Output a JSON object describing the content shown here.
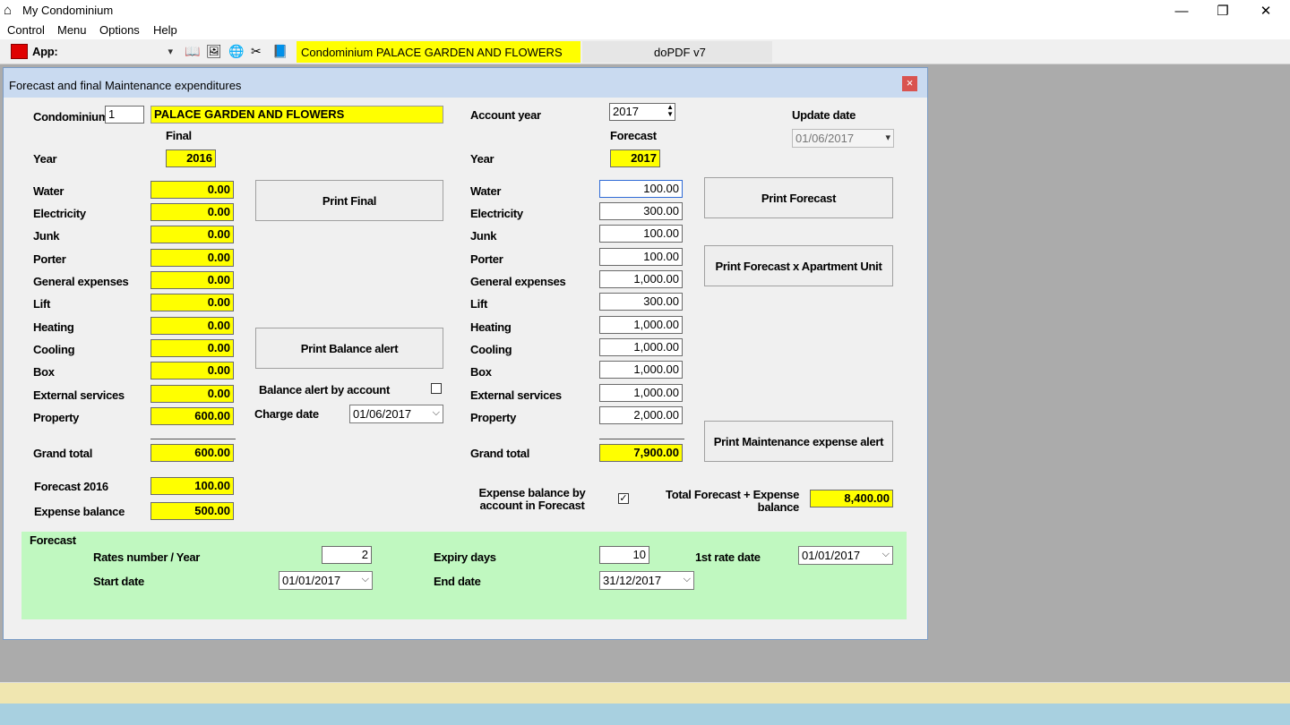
{
  "app": {
    "title": "My Condominium",
    "menu": [
      "Control",
      "Menu",
      "Options",
      "Help"
    ],
    "toolbar": {
      "app_label": "App:",
      "condo_label": "Condominium PALACE GARDEN AND FLOWERS",
      "printer_label": "doPDF v7"
    }
  },
  "form": {
    "title": "Forecast and final Maintenance expenditures",
    "close_glyph": "×",
    "condominium_label": "Condominium",
    "condominium_number": "1",
    "condominium_name": "PALACE GARDEN AND FLOWERS",
    "account_year_label": "Account year",
    "account_year": "2017",
    "update_date_label": "Update date",
    "update_date": "01/06/2017",
    "final_label": "Final",
    "forecast_label": "Forecast",
    "year_label": "Year",
    "final_year": "2016",
    "forecast_year": "2017",
    "expenses": [
      {
        "label": "Water",
        "final": "0.00",
        "forecast": "100.00"
      },
      {
        "label": "Electricity",
        "final": "0.00",
        "forecast": "300.00"
      },
      {
        "label": "Junk",
        "final": "0.00",
        "forecast": "100.00"
      },
      {
        "label": "Porter",
        "final": "0.00",
        "forecast": "100.00"
      },
      {
        "label": "General expenses",
        "final": "0.00",
        "forecast": "1,000.00"
      },
      {
        "label": "Lift",
        "final": "0.00",
        "forecast": "300.00"
      },
      {
        "label": "Heating",
        "final": "0.00",
        "forecast": "1,000.00"
      },
      {
        "label": "Cooling",
        "final": "0.00",
        "forecast": "1,000.00"
      },
      {
        "label": "Box",
        "final": "0.00",
        "forecast": "1,000.00"
      },
      {
        "label": "External services",
        "final": "0.00",
        "forecast": "1,000.00"
      },
      {
        "label": "Property",
        "final": "600.00",
        "forecast": "2,000.00"
      }
    ],
    "grand_total_label": "Grand total",
    "final_grand_total": "600.00",
    "forecast_grand_total": "7,900.00",
    "forecast_prev_label": "Forecast 2016",
    "forecast_prev_value": "100.00",
    "expense_balance_label": "Expense balance",
    "expense_balance_value": "500.00",
    "buttons": {
      "print_final": "Print Final",
      "print_balance_alert": "Print Balance alert",
      "print_forecast": "Print Forecast",
      "print_forecast_unit": "Print Forecast x Apartment Unit",
      "print_maintenance_alert": "Print Maintenance expense alert"
    },
    "balance_alert_by_account_label": "Balance alert by account",
    "balance_alert_by_account_checked": false,
    "charge_date_label": "Charge date",
    "charge_date": "01/06/2017",
    "expense_balance_by_account_label_1": "Expense balance by",
    "expense_balance_by_account_label_2": "account in Forecast",
    "expense_balance_by_account_checked": true,
    "total_forecast_label_1": "Total Forecast + Expense",
    "total_forecast_label_2": "balance",
    "total_forecast_value": "8,400.00"
  },
  "forecast_panel": {
    "title": "Forecast",
    "rates_label": "Rates number / Year",
    "rates_value": "2",
    "expiry_label": "Expiry days",
    "expiry_value": "10",
    "first_rate_label": "1st rate date",
    "first_rate_value": "01/01/2017",
    "start_label": "Start date",
    "start_value": "01/01/2017",
    "end_label": "End date",
    "end_value": "31/12/2017"
  },
  "colors": {
    "highlight": "#ffff00",
    "panel_green": "#c0f8c0",
    "title_blue": "#c9daf0",
    "close_red": "#d9534f"
  },
  "icons": [
    "app-house-icon",
    "minimize-icon",
    "maximize-icon",
    "close-icon",
    "app-red-icon",
    "book-icon",
    "photo-icon",
    "globe-icon",
    "scissors-icon",
    "open-book-icon",
    "checkmark-icon",
    "dropdown-arrow-icon",
    "spin-arrows-icon"
  ]
}
